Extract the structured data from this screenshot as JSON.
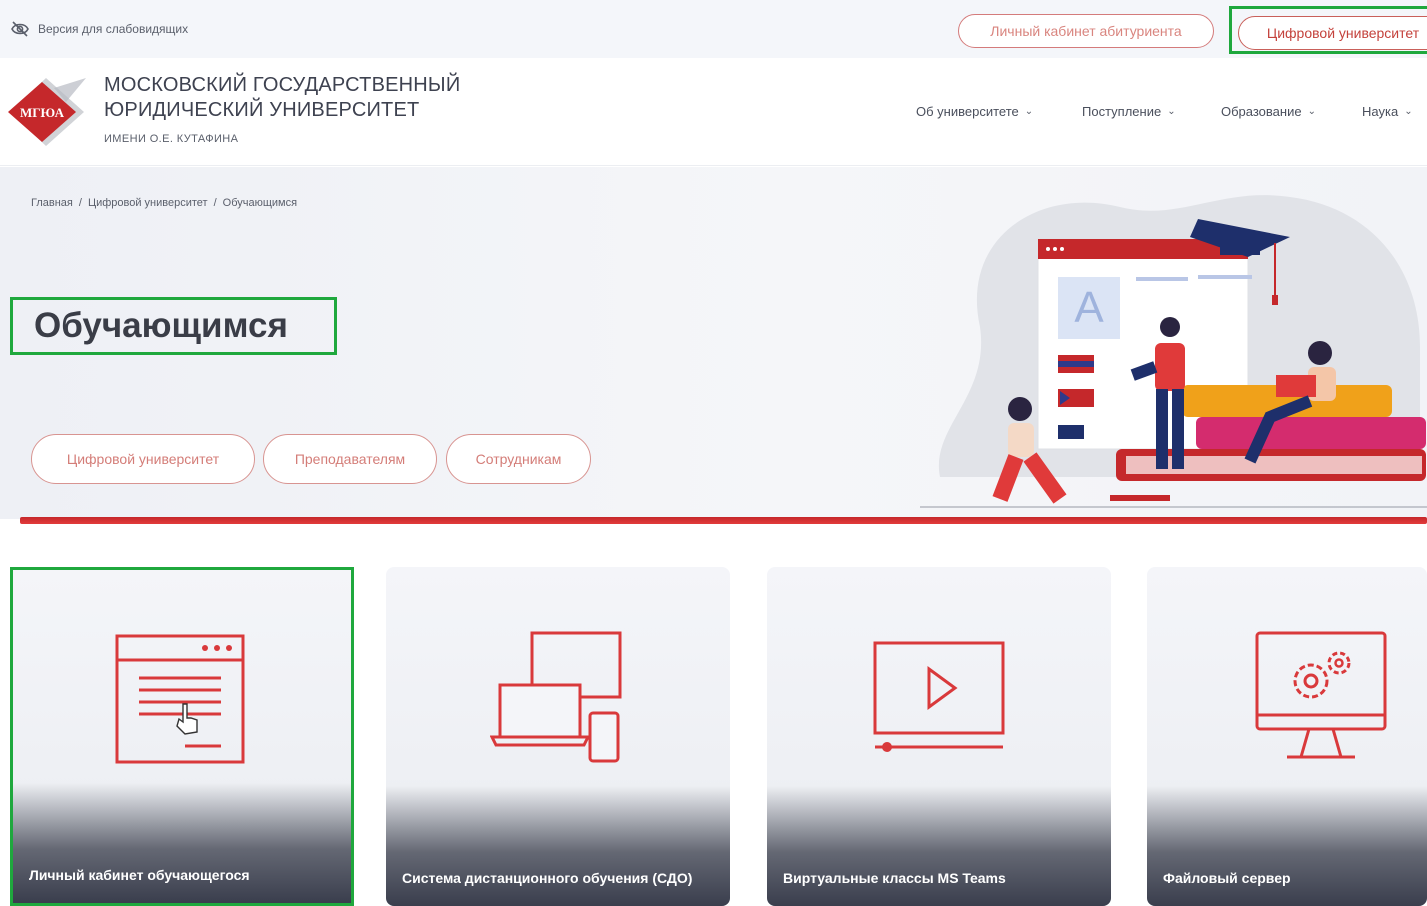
{
  "topbar": {
    "low_vision": "Версия для слабовидящих",
    "applicant_cabinet": "Личный кабинет абитуриента",
    "digital_university": "Цифровой университет"
  },
  "header": {
    "logo_text": "МГЮА",
    "university_line1": "МОСКОВСКИЙ ГОСУДАРСТВЕННЫЙ",
    "university_line2": "ЮРИДИЧЕСКИЙ УНИВЕРСИТЕТ",
    "university_line3": "ИМЕНИ О.Е. КУТАФИНА",
    "nav": [
      {
        "label": "Об университете"
      },
      {
        "label": "Поступление"
      },
      {
        "label": "Образование"
      },
      {
        "label": "Наука"
      }
    ]
  },
  "breadcrumb": {
    "home": "Главная",
    "separator": "/",
    "section": "Цифровой университет",
    "current": "Обучающимся"
  },
  "hero": {
    "title": "Обучающимся",
    "buttons": [
      {
        "label": "Цифровой университет"
      },
      {
        "label": "Преподавателям"
      },
      {
        "label": "Сотрудникам"
      }
    ]
  },
  "cards": [
    {
      "label": "Личный кабинет обучающегося",
      "icon": "browser-window-cursor-icon"
    },
    {
      "label": "Система дистанционного обучения (СДО)",
      "icon": "devices-icon"
    },
    {
      "label": "Виртуальные классы MS Teams",
      "icon": "video-player-icon"
    },
    {
      "label": "Файловый сервер",
      "icon": "monitor-gear-icon"
    }
  ],
  "colors": {
    "brand_red": "#c5282b",
    "highlight_green": "#1fa83d",
    "icon_red": "#d9393b"
  }
}
